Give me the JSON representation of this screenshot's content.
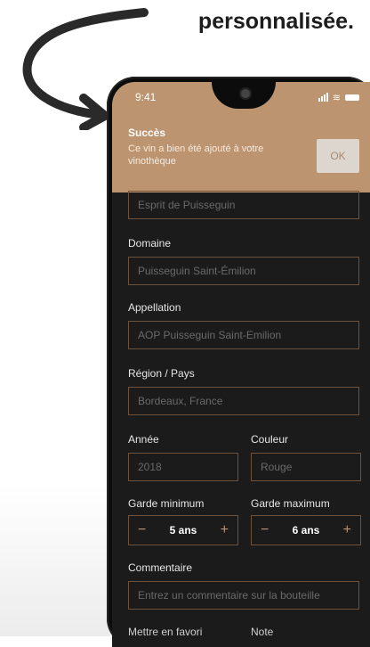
{
  "caption": "personnalisée.",
  "status": {
    "time": "9:41"
  },
  "toast": {
    "title": "Succès",
    "message": "Ce vin a bien été ajouté à votre vinothèque",
    "ok_label": "OK"
  },
  "form": {
    "name_value": "Esprit de Puisseguin",
    "domain": {
      "label": "Domaine",
      "value": "Puisseguin Saint-Émilion"
    },
    "appellation": {
      "label": "Appellation",
      "value": "AOP Puisseguin Saint-Emilion"
    },
    "region": {
      "label": "Région / Pays",
      "value": "Bordeaux, France"
    },
    "year": {
      "label": "Année",
      "value": "2018"
    },
    "color": {
      "label": "Couleur",
      "value": "Rouge"
    },
    "garde_min": {
      "label": "Garde minimum",
      "value": "5 ans"
    },
    "garde_max": {
      "label": "Garde maximum",
      "value": "6 ans"
    },
    "comment": {
      "label": "Commentaire",
      "placeholder": "Entrez un commentaire sur la bouteille"
    },
    "favorite_label": "Mettre en favori",
    "note_label": "Note",
    "minus": "−",
    "plus": "+"
  },
  "colors": {
    "accent": "#bd9470",
    "field_border": "#6e5138",
    "screen_bg": "#1b1b1b"
  }
}
